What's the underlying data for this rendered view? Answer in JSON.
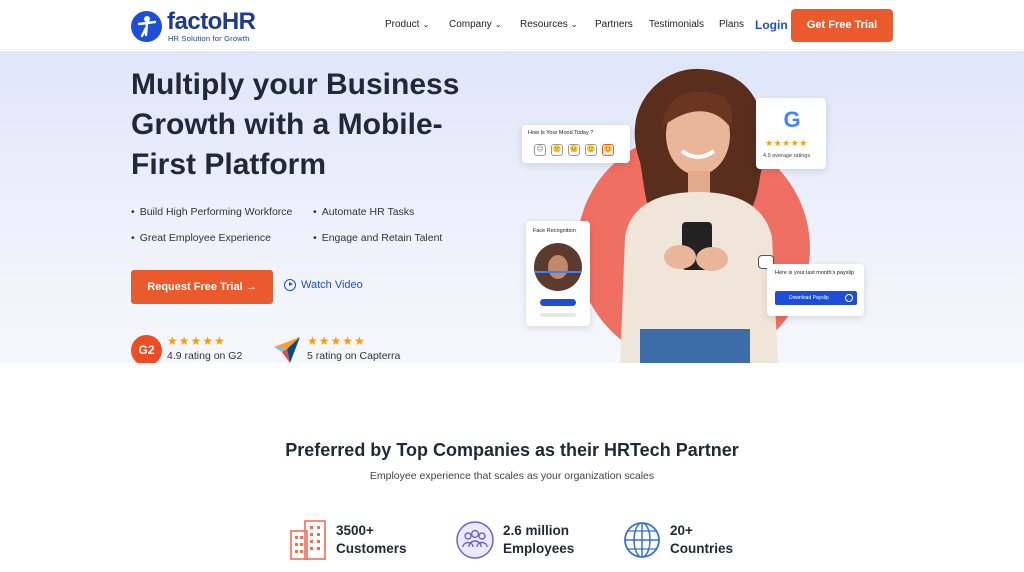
{
  "header": {
    "brand": "factoHR",
    "tagline": "HR Solution for Growth",
    "nav": [
      {
        "label": "Product",
        "has_dropdown": true
      },
      {
        "label": "Company",
        "has_dropdown": true
      },
      {
        "label": "Resources",
        "has_dropdown": true
      },
      {
        "label": "Partners",
        "has_dropdown": false
      },
      {
        "label": "Testimonials",
        "has_dropdown": false
      },
      {
        "label": "Plans",
        "has_dropdown": false
      }
    ],
    "login_label": "Login",
    "cta_label": "Get Free Trial"
  },
  "hero": {
    "headline": "Multiply your Business Growth with a Mobile-First Platform",
    "bullets": [
      "Build High Performing Workforce",
      "Automate HR Tasks",
      "Great Employee Experience",
      "Engage and Retain Talent"
    ],
    "primary_button": "Request Free Trial →",
    "video_link": "Watch Video",
    "ratings": [
      {
        "badge": "G2",
        "stars": 5,
        "text": "4.9 rating on G2"
      },
      {
        "badge": "capterra-icon",
        "stars": 5,
        "text": "5 rating on Capterra"
      }
    ],
    "mood_card": {
      "title": "How Is Your Mood Today ?",
      "faces": [
        "☹",
        "🙁",
        "😐",
        "🙂",
        "😊"
      ]
    },
    "google_card": {
      "logo": "G",
      "stars": 5,
      "text": "4.9 average ratings"
    },
    "face_card": {
      "title": "Face Recognition"
    },
    "payslip_card": {
      "text": "Here is your last month's payslip",
      "button": "Download Payslip"
    }
  },
  "partners": {
    "title": "Preferred by Top Companies as their HRTech Partner",
    "subtitle": "Employee experience that scales as your organization scales",
    "stats": [
      {
        "icon": "building-icon",
        "value": "3500+",
        "label": "Customers"
      },
      {
        "icon": "people-icon",
        "value": "2.6 million",
        "label": "Employees"
      },
      {
        "icon": "globe-icon",
        "value": "20+",
        "label": "Countries"
      }
    ]
  },
  "colors": {
    "accent": "#ea5a2c",
    "brand": "#1d4ed8",
    "star": "#f59e0b"
  }
}
